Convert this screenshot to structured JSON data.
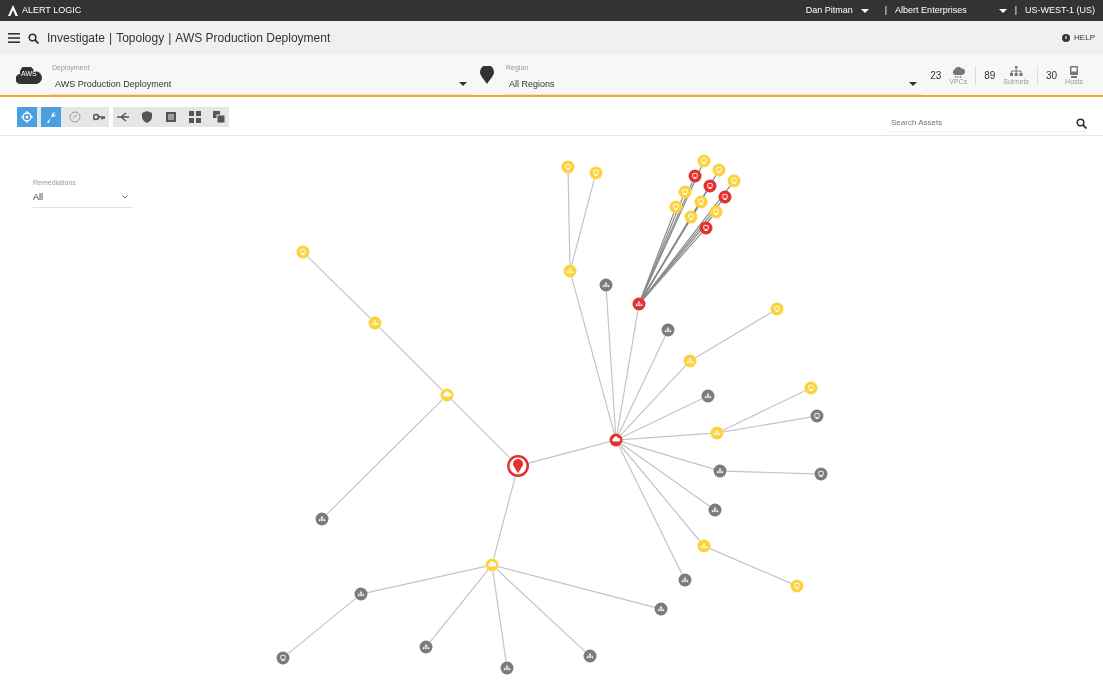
{
  "topbar": {
    "brand": "ALERT LOGIC",
    "user": "Dan Pitman",
    "separator_1": "|",
    "account": "Albert Enterprises",
    "separator_2": "|",
    "region": "US-WEST-1 (US)"
  },
  "breadcrumb": [
    "Investigate",
    "|",
    "Topology",
    "|",
    "AWS Production Deployment"
  ],
  "help": "HELP",
  "deployment": {
    "badge": "AWS",
    "label": "Deployment",
    "value": "AWS Production Deployment"
  },
  "region_select": {
    "label": "Region",
    "value": "All Regions"
  },
  "stats": [
    {
      "kind": "vpc",
      "count": "23",
      "label": "VPCs"
    },
    {
      "kind": "subnet",
      "count": "89",
      "label": "Subnets"
    },
    {
      "kind": "host",
      "count": "30",
      "label": "Hosts"
    }
  ],
  "toolbar_groups": [
    [
      {
        "kind": "target",
        "selected": true
      },
      {
        "kind": "wrench",
        "selected": true
      },
      {
        "kind": "gauge",
        "selected": false
      },
      {
        "kind": "key",
        "selected": false
      }
    ],
    [
      {
        "kind": "branch",
        "selected": false
      },
      {
        "kind": "shield",
        "selected": false
      },
      {
        "kind": "list",
        "selected": false
      },
      {
        "kind": "grid",
        "selected": false
      },
      {
        "kind": "layers",
        "selected": false
      }
    ]
  ],
  "search": {
    "placeholder": "Search Assets"
  },
  "remediations": {
    "label": "Remediations",
    "value": "All"
  },
  "topology": {
    "kind": "region",
    "color": "#e2312f",
    "children": [
      {
        "kind": "vpc",
        "color": "#fdd23f",
        "children": [
          {
            "kind": "subnet",
            "color": "#fdd23f",
            "children": [
              {
                "kind": "host",
                "color": "#fdd23f"
              }
            ]
          },
          {
            "kind": "subnet",
            "color": "#7b7b7b"
          }
        ]
      },
      {
        "kind": "vpc",
        "color": "#e2312f",
        "children": [
          {
            "kind": "subnet",
            "color": "#fdd23f",
            "children": [
              {
                "kind": "host",
                "color": "#fdd23f"
              },
              {
                "kind": "host",
                "color": "#fdd23f"
              }
            ]
          },
          {
            "kind": "subnet",
            "color": "#7b7b7b"
          },
          {
            "kind": "subnet",
            "color": "#e2312f",
            "children": [
              {
                "kind": "host",
                "color": "#fdd23f"
              },
              {
                "kind": "host",
                "color": "#e2312f"
              },
              {
                "kind": "host",
                "color": "#fdd23f"
              },
              {
                "kind": "host",
                "color": "#fdd23f"
              },
              {
                "kind": "host",
                "color": "#e2312f"
              },
              {
                "kind": "host",
                "color": "#fdd23f"
              },
              {
                "kind": "host",
                "color": "#fdd23f"
              },
              {
                "kind": "host",
                "color": "#fdd23f"
              },
              {
                "kind": "host",
                "color": "#e2312f"
              },
              {
                "kind": "host",
                "color": "#fdd23f"
              },
              {
                "kind": "host",
                "color": "#fdd23f"
              },
              {
                "kind": "host",
                "color": "#e2312f"
              }
            ]
          },
          {
            "kind": "subnet",
            "color": "#7b7b7b"
          },
          {
            "kind": "subnet",
            "color": "#fdd23f",
            "children": [
              {
                "kind": "host",
                "color": "#fdd23f"
              }
            ]
          },
          {
            "kind": "subnet",
            "color": "#7b7b7b"
          },
          {
            "kind": "subnet",
            "color": "#fdd23f",
            "children": [
              {
                "kind": "host",
                "color": "#fdd23f"
              },
              {
                "kind": "host",
                "color": "#7b7b7b"
              }
            ]
          },
          {
            "kind": "subnet",
            "color": "#7b7b7b",
            "children": [
              {
                "kind": "host",
                "color": "#7b7b7b"
              }
            ]
          },
          {
            "kind": "subnet",
            "color": "#7b7b7b"
          },
          {
            "kind": "subnet",
            "color": "#fdd23f",
            "children": [
              {
                "kind": "host",
                "color": "#fdd23f"
              }
            ]
          },
          {
            "kind": "subnet",
            "color": "#7b7b7b"
          }
        ]
      },
      {
        "kind": "vpc",
        "color": "#fdd23f",
        "children": [
          {
            "kind": "subnet",
            "color": "#7b7b7b",
            "children": [
              {
                "kind": "host",
                "color": "#7b7b7b"
              }
            ]
          },
          {
            "kind": "subnet",
            "color": "#7b7b7b"
          },
          {
            "kind": "subnet",
            "color": "#7b7b7b"
          },
          {
            "kind": "subnet",
            "color": "#7b7b7b"
          },
          {
            "kind": "subnet",
            "color": "#7b7b7b"
          }
        ]
      }
    ]
  }
}
